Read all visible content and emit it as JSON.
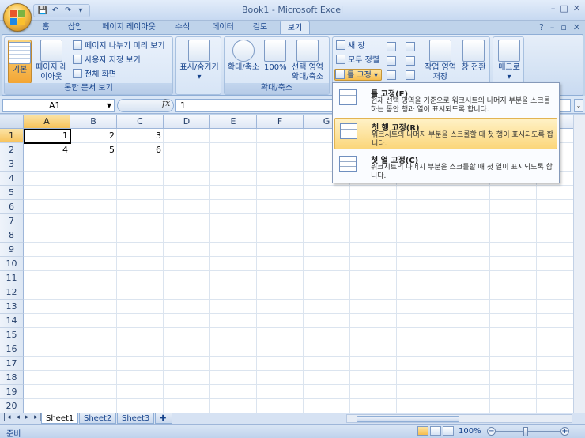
{
  "window": {
    "title": "Book1 - Microsoft Excel",
    "min": "–",
    "max": "□",
    "close": "✕"
  },
  "tabs": [
    "홈",
    "삽입",
    "페이지 레이아웃",
    "수식",
    "데이터",
    "검토",
    "보기"
  ],
  "active_tab": "보기",
  "ribbon": {
    "groups": {
      "workbook_views": {
        "label": "통합 문서 보기",
        "normal": "기본",
        "page_layout": "페이지 레이아웃",
        "page_break_preview": "페이지 나누기 미리 보기",
        "custom_views": "사용자 지정 보기",
        "full_screen": "전체 화면"
      },
      "show_hide": {
        "label": "표시/숨기기"
      },
      "zoom": {
        "label": "확대/축소",
        "zoom": "확대/축소",
        "hundred": "100%",
        "zoom_selection": "선택 영역 확대/축소"
      },
      "window": {
        "new_window": "새 창",
        "arrange_all": "모두 정렬",
        "freeze_panes": "틀 고정",
        "save_workspace": "작업 영역 저장",
        "switch_windows": "창 전환"
      },
      "macros": {
        "macros": "매크로"
      }
    }
  },
  "formula_bar": {
    "name_box": "A1",
    "fx": "fx",
    "value": "1"
  },
  "grid": {
    "columns": [
      "A",
      "B",
      "C",
      "D",
      "E",
      "F",
      "G"
    ],
    "rows": [
      "1",
      "2",
      "3",
      "4",
      "5",
      "6",
      "7",
      "8",
      "9",
      "10",
      "11",
      "12",
      "13",
      "14",
      "15",
      "16",
      "17",
      "18",
      "19",
      "20"
    ],
    "cells": [
      [
        "1",
        "2",
        "3"
      ],
      [
        "4",
        "5",
        "6"
      ]
    ],
    "active_cell": "A1"
  },
  "freeze_menu": {
    "items": [
      {
        "title": "틀 고정(F)",
        "desc": "현재 선택 영역을 기준으로 워크시트의 나머지 부분을 스크롤하는 동안 행과 열이 표시되도록 합니다."
      },
      {
        "title": "첫 행 고정(R)",
        "desc": "워크시트의 나머지 부분을 스크롤할 때 첫 행이 표시되도록 합니다."
      },
      {
        "title": "첫 열 고정(C)",
        "desc": "워크시트의 나머지 부분을 스크롤할 때 첫 열이 표시되도록 합니다."
      }
    ],
    "highlighted_index": 1
  },
  "sheets": [
    "Sheet1",
    "Sheet2",
    "Sheet3"
  ],
  "active_sheet": "Sheet1",
  "status": {
    "ready": "준비",
    "zoom": "100%"
  }
}
